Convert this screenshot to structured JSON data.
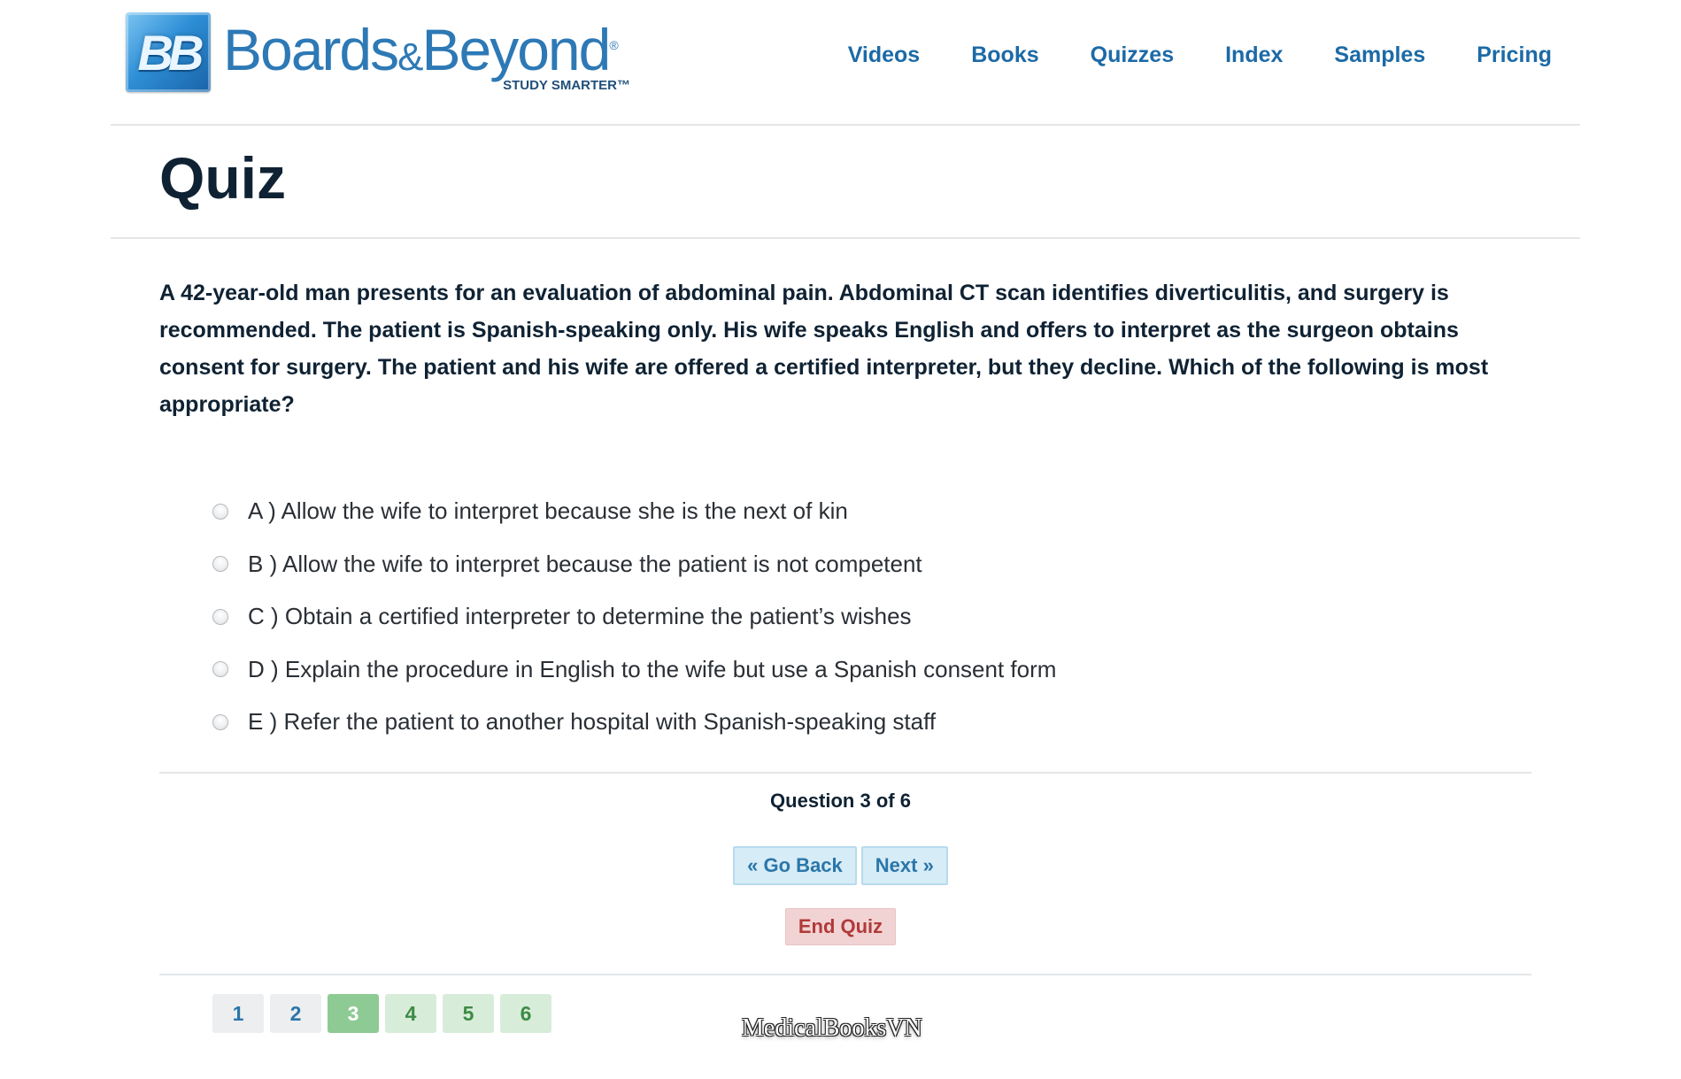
{
  "brand": {
    "badge_text": "BB",
    "name_part1": "Boards",
    "name_amp": "&",
    "name_part2": "Beyond",
    "registered": "®",
    "tagline": "STUDY SMARTER™",
    "colors": {
      "brand_blue": "#2d79b6",
      "nav_blue": "#1c6aa6"
    }
  },
  "nav": {
    "items": [
      {
        "label": "Videos"
      },
      {
        "label": "Books"
      },
      {
        "label": "Quizzes"
      },
      {
        "label": "Index"
      },
      {
        "label": "Samples"
      },
      {
        "label": "Pricing"
      }
    ]
  },
  "page": {
    "title": "Quiz"
  },
  "quiz": {
    "question": "A 42-year-old man presents for an evaluation of abdominal pain. Abdominal CT scan identifies diverticulitis, and surgery is recommended. The patient is Spanish-speaking only. His wife speaks English and offers to interpret as the surgeon obtains consent for surgery. The patient and his wife are offered a certified interpreter, but they decline. Which of the following is most appropriate?",
    "options": [
      {
        "label": "A ) Allow the wife to interpret because she is the next of kin",
        "selected": false
      },
      {
        "label": "B ) Allow the wife to interpret because the patient is not competent",
        "selected": false
      },
      {
        "label": "C ) Obtain a certified interpreter to determine the patient’s wishes",
        "selected": false
      },
      {
        "label": "D ) Explain the procedure in English to the wife but use a Spanish consent form",
        "selected": false
      },
      {
        "label": "E ) Refer the patient to another hospital with Spanish-speaking staff",
        "selected": false
      }
    ],
    "progress_text": "Question 3 of 6",
    "current_question": 3,
    "total_questions": 6,
    "buttons": {
      "back": "« Go Back",
      "next": "Next »",
      "end": "End Quiz"
    },
    "pager": [
      {
        "label": "1",
        "state": "visited"
      },
      {
        "label": "2",
        "state": "visited"
      },
      {
        "label": "3",
        "state": "current"
      },
      {
        "label": "4",
        "state": "pending"
      },
      {
        "label": "5",
        "state": "pending"
      },
      {
        "label": "6",
        "state": "pending"
      }
    ],
    "colors": {
      "current_page": "#8ecb94",
      "pending_page": "#d8edd9",
      "end_button": "#f2d3d3",
      "nav_button": "#d6ecf6"
    }
  },
  "watermark": {
    "text": "MedicalBooksVN"
  }
}
